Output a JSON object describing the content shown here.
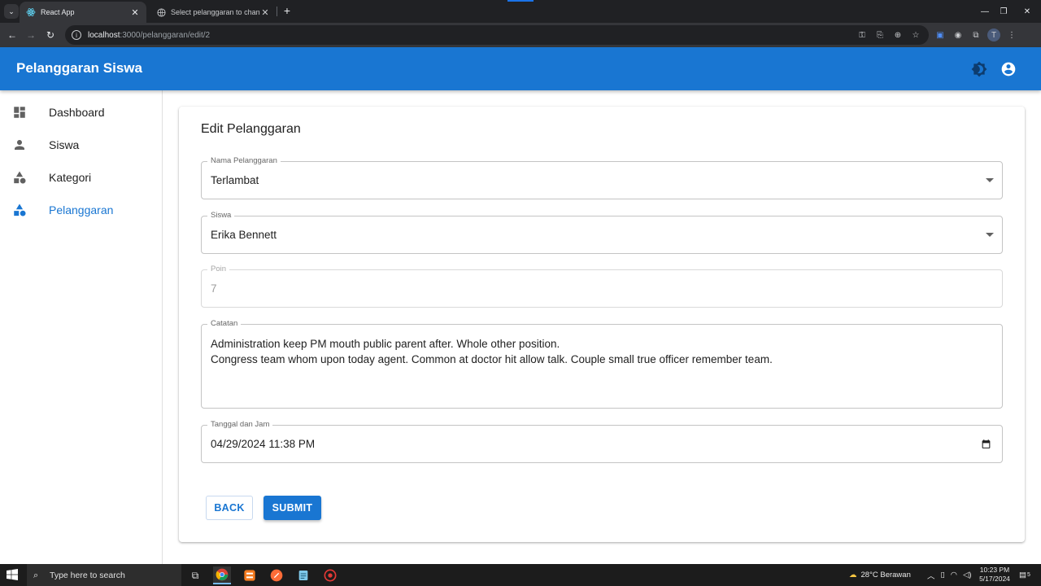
{
  "browser": {
    "tabs": [
      {
        "title": "React App",
        "active": true
      },
      {
        "title": "Select pelanggaran to change |",
        "active": false
      }
    ],
    "url_host": "localhost",
    "url_path": ":3000/pelanggaran/edit/2"
  },
  "app": {
    "title": "Pelanggaran Siswa",
    "icons": [
      "theme-toggle-icon",
      "account-circle-icon"
    ]
  },
  "sidebar": {
    "items": [
      {
        "label": "Dashboard",
        "icon": "dashboard-icon",
        "active": false
      },
      {
        "label": "Siswa",
        "icon": "person-icon",
        "active": false
      },
      {
        "label": "Kategori",
        "icon": "category-icon",
        "active": false
      },
      {
        "label": "Pelanggaran",
        "icon": "category-icon",
        "active": true
      }
    ]
  },
  "form": {
    "title": "Edit Pelanggaran",
    "nama_pelanggaran": {
      "label": "Nama Pelanggaran",
      "value": "Terlambat"
    },
    "siswa": {
      "label": "Siswa",
      "value": "Erika Bennett"
    },
    "poin": {
      "label": "Poin",
      "value": "7"
    },
    "catatan": {
      "label": "Catatan",
      "line1": "Administration keep PM mouth public parent after. Whole other position.",
      "line2": "Congress team whom upon today agent. Common at doctor hit allow talk. Couple small true officer remember team."
    },
    "tanggal": {
      "label": "Tanggal dan Jam",
      "value": "04/29/2024 11:38 PM"
    },
    "back_label": "BACK",
    "submit_label": "SUBMIT"
  },
  "taskbar": {
    "search_placeholder": "Type here to search",
    "weather": "28°C  Berawan",
    "time": "10:23 PM",
    "date": "5/17/2024",
    "notification_count": "5"
  },
  "colors": {
    "primary": "#1976d2",
    "chrome_dark": "#202124",
    "chrome_toolbar": "#35363a"
  }
}
